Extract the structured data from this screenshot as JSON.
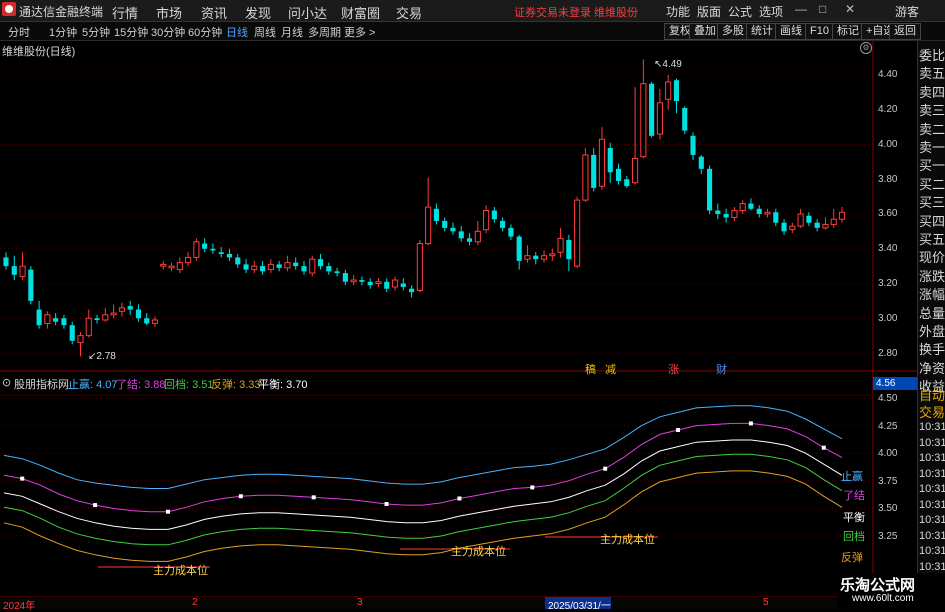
{
  "titlebar": {
    "app_name": "通达信金融终端",
    "menus": [
      "行情",
      "市场",
      "资讯",
      "发现",
      "问小达",
      "财富圈",
      "交易"
    ],
    "warning": "证券交易未登录 维维股份",
    "right": [
      "功能",
      "版面",
      "公式",
      "选项"
    ],
    "guest": "游客"
  },
  "toolbar": {
    "periods": [
      "分时",
      "1分钟",
      "5分钟",
      "15分钟",
      "30分钟",
      "60分钟",
      "日线",
      "周线",
      "月线",
      "多周期",
      "更多 >"
    ],
    "active_period": "日线",
    "buttons": [
      "复权",
      "叠加",
      "多股",
      "统计",
      "画线",
      "F10",
      "标记",
      "+自选",
      "返回"
    ]
  },
  "sidebar": {
    "items": [
      "委比",
      "卖五",
      "卖四",
      "卖三",
      "卖二",
      "卖一",
      "买一",
      "买二",
      "买三",
      "买四",
      "买五",
      "现价",
      "涨跌",
      "涨幅",
      "总量",
      "外盘",
      "换手",
      "净资",
      "收益"
    ],
    "bottom": [
      "自动",
      "交易",
      "10:31",
      "10:31",
      "10:31",
      "10:31",
      "10:31",
      "10:31",
      "10:31",
      "10:31",
      "10:31",
      "10:31",
      "10:32"
    ]
  },
  "main_chart": {
    "label": "维维股份(日线)",
    "price_ticks": [
      "4.40",
      "4.20",
      "4.00",
      "3.80",
      "3.60",
      "3.40",
      "3.20",
      "3.00",
      "2.80"
    ],
    "high_label": "4.49",
    "low_label": "2.78",
    "events": [
      {
        "text": "稿",
        "color": "#e8c200"
      },
      {
        "text": "减",
        "color": "#e8c200"
      },
      {
        "text": "涨",
        "color": "#ff4040"
      },
      {
        "text": "财",
        "color": "#4a8cff"
      }
    ]
  },
  "indicator": {
    "name": "股朋指标网",
    "legend": [
      {
        "label": "止赢:",
        "value": "4.07",
        "color": "#4ab3ff"
      },
      {
        "label": "了结:",
        "value": "3.88",
        "color": "#e040e0"
      },
      {
        "label": "回档:",
        "value": "3.51",
        "color": "#40d040"
      },
      {
        "label": "反弹:",
        "value": "3.33",
        "color": "#e0a020"
      },
      {
        "label": "平衡:",
        "value": "3.70",
        "color": "#ffffff"
      }
    ],
    "price_box": "4.56",
    "ticks": [
      "4.50",
      "4.25",
      "4.00",
      "3.75",
      "3.50",
      "3.25"
    ],
    "line_labels": [
      "止赢",
      "了结",
      "平衡",
      "回档",
      "反弹"
    ],
    "cost_label": "主力成本位"
  },
  "date_axis": [
    "2024年",
    "2",
    "3",
    "2025/03/31/一",
    "5"
  ],
  "watermark": {
    "title": "乐淘公式网",
    "url": "www.60lt.com"
  },
  "colors": {
    "up": "#ff3c3c",
    "down": "#00e0e0",
    "ma": "#ffffff"
  },
  "candles": [
    [
      3.35,
      3.3,
      3.38,
      3.28
    ],
    [
      3.3,
      3.25,
      3.36,
      3.22
    ],
    [
      3.24,
      3.3,
      3.38,
      3.22
    ],
    [
      3.28,
      3.1,
      3.3,
      3.08
    ],
    [
      3.05,
      2.96,
      3.1,
      2.94
    ],
    [
      2.97,
      3.02,
      3.04,
      2.94
    ],
    [
      3.0,
      2.98,
      3.03,
      2.96
    ],
    [
      3.0,
      2.96,
      3.02,
      2.94
    ],
    [
      2.96,
      2.87,
      2.98,
      2.85
    ],
    [
      2.86,
      2.9,
      2.92,
      2.78
    ],
    [
      2.9,
      3.0,
      3.05,
      2.89
    ],
    [
      3.0,
      2.99,
      3.02,
      2.97
    ],
    [
      2.99,
      3.02,
      3.06,
      2.98
    ],
    [
      3.02,
      3.03,
      3.08,
      3.0
    ],
    [
      3.04,
      3.06,
      3.09,
      3.01
    ],
    [
      3.07,
      3.05,
      3.1,
      3.02
    ],
    [
      3.05,
      3.0,
      3.08,
      2.98
    ],
    [
      3.0,
      2.97,
      3.03,
      2.96
    ],
    [
      2.97,
      2.99,
      3.01,
      2.95
    ],
    [
      3.3,
      3.31,
      3.33,
      3.28
    ],
    [
      3.29,
      3.3,
      3.32,
      3.27
    ],
    [
      3.28,
      3.32,
      3.35,
      3.26
    ],
    [
      3.32,
      3.35,
      3.38,
      3.3
    ],
    [
      3.35,
      3.44,
      3.46,
      3.33
    ],
    [
      3.43,
      3.4,
      3.46,
      3.38
    ],
    [
      3.4,
      3.39,
      3.43,
      3.37
    ],
    [
      3.38,
      3.37,
      3.41,
      3.35
    ],
    [
      3.37,
      3.35,
      3.4,
      3.33
    ],
    [
      3.35,
      3.31,
      3.37,
      3.29
    ],
    [
      3.31,
      3.28,
      3.34,
      3.26
    ],
    [
      3.28,
      3.3,
      3.33,
      3.26
    ],
    [
      3.3,
      3.27,
      3.33,
      3.25
    ],
    [
      3.28,
      3.31,
      3.34,
      3.26
    ],
    [
      3.31,
      3.29,
      3.33,
      3.27
    ],
    [
      3.29,
      3.32,
      3.36,
      3.27
    ],
    [
      3.32,
      3.3,
      3.35,
      3.28
    ],
    [
      3.3,
      3.27,
      3.33,
      3.25
    ],
    [
      3.26,
      3.34,
      3.36,
      3.24
    ],
    [
      3.34,
      3.3,
      3.37,
      3.28
    ],
    [
      3.3,
      3.27,
      3.32,
      3.25
    ],
    [
      3.27,
      3.26,
      3.29,
      3.24
    ],
    [
      3.26,
      3.21,
      3.28,
      3.19
    ],
    [
      3.21,
      3.22,
      3.25,
      3.19
    ],
    [
      3.22,
      3.21,
      3.24,
      3.19
    ],
    [
      3.21,
      3.19,
      3.23,
      3.17
    ],
    [
      3.2,
      3.21,
      3.23,
      3.18
    ],
    [
      3.21,
      3.17,
      3.23,
      3.15
    ],
    [
      3.18,
      3.22,
      3.24,
      3.16
    ],
    [
      3.2,
      3.18,
      3.23,
      3.16
    ],
    [
      3.17,
      3.15,
      3.19,
      3.12
    ],
    [
      3.16,
      3.43,
      3.45,
      3.15
    ],
    [
      3.43,
      3.64,
      3.81,
      3.42
    ],
    [
      3.63,
      3.56,
      3.66,
      3.54
    ],
    [
      3.56,
      3.52,
      3.58,
      3.5
    ],
    [
      3.52,
      3.5,
      3.55,
      3.48
    ],
    [
      3.5,
      3.46,
      3.53,
      3.44
    ],
    [
      3.46,
      3.44,
      3.49,
      3.42
    ],
    [
      3.44,
      3.5,
      3.56,
      3.42
    ],
    [
      3.51,
      3.62,
      3.65,
      3.49
    ],
    [
      3.62,
      3.57,
      3.64,
      3.55
    ],
    [
      3.56,
      3.52,
      3.58,
      3.5
    ],
    [
      3.52,
      3.47,
      3.54,
      3.45
    ],
    [
      3.47,
      3.33,
      3.48,
      3.28
    ],
    [
      3.34,
      3.36,
      3.42,
      3.32
    ],
    [
      3.36,
      3.34,
      3.38,
      3.31
    ],
    [
      3.34,
      3.36,
      3.39,
      3.32
    ],
    [
      3.36,
      3.37,
      3.4,
      3.33
    ],
    [
      3.38,
      3.46,
      3.52,
      3.35
    ],
    [
      3.45,
      3.34,
      3.48,
      3.27
    ],
    [
      3.3,
      3.68,
      3.7,
      3.29
    ],
    [
      3.68,
      3.94,
      3.98,
      3.67
    ],
    [
      3.94,
      3.75,
      3.98,
      3.73
    ],
    [
      3.76,
      4.03,
      4.1,
      3.74
    ],
    [
      3.98,
      3.84,
      4.01,
      3.78
    ],
    [
      3.86,
      3.79,
      3.89,
      3.77
    ],
    [
      3.8,
      3.76,
      3.82,
      3.75
    ],
    [
      3.78,
      3.92,
      4.33,
      3.77
    ],
    [
      3.93,
      4.35,
      4.49,
      3.92
    ],
    [
      4.35,
      4.05,
      4.36,
      4.04
    ],
    [
      4.06,
      4.24,
      4.32,
      4.03
    ],
    [
      4.26,
      4.36,
      4.4,
      4.2
    ],
    [
      4.37,
      4.25,
      4.38,
      4.18
    ],
    [
      4.21,
      4.08,
      4.22,
      4.06
    ],
    [
      4.05,
      3.94,
      4.07,
      3.91
    ],
    [
      3.93,
      3.86,
      3.94,
      3.83
    ],
    [
      3.86,
      3.62,
      3.88,
      3.6
    ],
    [
      3.62,
      3.6,
      3.66,
      3.57
    ],
    [
      3.6,
      3.58,
      3.63,
      3.55
    ],
    [
      3.58,
      3.62,
      3.64,
      3.56
    ],
    [
      3.62,
      3.66,
      3.68,
      3.6
    ],
    [
      3.66,
      3.63,
      3.69,
      3.62
    ],
    [
      3.63,
      3.6,
      3.65,
      3.58
    ],
    [
      3.6,
      3.61,
      3.63,
      3.58
    ],
    [
      3.61,
      3.55,
      3.63,
      3.53
    ],
    [
      3.55,
      3.5,
      3.57,
      3.48
    ],
    [
      3.51,
      3.53,
      3.55,
      3.49
    ],
    [
      3.53,
      3.6,
      3.63,
      3.52
    ],
    [
      3.59,
      3.55,
      3.61,
      3.53
    ],
    [
      3.55,
      3.52,
      3.57,
      3.5
    ],
    [
      3.52,
      3.54,
      3.58,
      3.51
    ],
    [
      3.54,
      3.57,
      3.63,
      3.52
    ],
    [
      3.57,
      3.61,
      3.64,
      3.55
    ]
  ],
  "bands": {
    "zhiying": [
      3.98,
      3.95,
      3.89,
      3.82,
      3.76,
      3.73,
      3.71,
      3.69,
      3.68,
      3.68,
      3.72,
      3.76,
      3.78,
      3.8,
      3.81,
      3.81,
      3.8,
      3.79,
      3.78,
      3.77,
      3.75,
      3.73,
      3.72,
      3.72,
      3.74,
      3.78,
      3.81,
      3.84,
      3.87,
      3.88,
      3.9,
      3.94,
      3.99,
      4.04,
      4.14,
      4.25,
      4.33,
      4.37,
      4.41,
      4.42,
      4.43,
      4.43,
      4.41,
      4.38,
      4.31,
      4.22,
      4.13
    ],
    "liaojie": [
      3.8,
      3.77,
      3.71,
      3.63,
      3.57,
      3.53,
      3.5,
      3.48,
      3.47,
      3.47,
      3.51,
      3.56,
      3.59,
      3.61,
      3.62,
      3.62,
      3.61,
      3.6,
      3.59,
      3.58,
      3.56,
      3.54,
      3.53,
      3.53,
      3.55,
      3.59,
      3.62,
      3.65,
      3.68,
      3.69,
      3.71,
      3.75,
      3.81,
      3.86,
      3.96,
      4.08,
      4.17,
      4.21,
      4.25,
      4.26,
      4.27,
      4.27,
      4.25,
      4.22,
      4.15,
      4.05,
      3.96
    ],
    "pingheng": [
      3.64,
      3.61,
      3.54,
      3.47,
      3.41,
      3.37,
      3.34,
      3.32,
      3.31,
      3.31,
      3.35,
      3.4,
      3.43,
      3.45,
      3.46,
      3.46,
      3.45,
      3.44,
      3.43,
      3.42,
      3.4,
      3.38,
      3.37,
      3.37,
      3.39,
      3.43,
      3.46,
      3.49,
      3.52,
      3.54,
      3.56,
      3.6,
      3.66,
      3.71,
      3.81,
      3.93,
      4.02,
      4.06,
      4.1,
      4.11,
      4.12,
      4.12,
      4.1,
      4.07,
      4.0,
      3.9,
      3.8
    ],
    "huidang": [
      3.51,
      3.48,
      3.41,
      3.33,
      3.27,
      3.23,
      3.2,
      3.18,
      3.17,
      3.17,
      3.21,
      3.26,
      3.29,
      3.31,
      3.32,
      3.32,
      3.31,
      3.3,
      3.29,
      3.28,
      3.26,
      3.24,
      3.23,
      3.23,
      3.25,
      3.29,
      3.32,
      3.35,
      3.38,
      3.4,
      3.42,
      3.46,
      3.52,
      3.57,
      3.68,
      3.8,
      3.89,
      3.93,
      3.97,
      3.98,
      3.99,
      3.99,
      3.97,
      3.94,
      3.87,
      3.76,
      3.66
    ],
    "fantan": [
      3.37,
      3.33,
      3.25,
      3.18,
      3.12,
      3.08,
      3.05,
      3.03,
      3.02,
      3.02,
      3.06,
      3.11,
      3.14,
      3.16,
      3.17,
      3.17,
      3.16,
      3.15,
      3.14,
      3.13,
      3.11,
      3.09,
      3.08,
      3.08,
      3.1,
      3.14,
      3.17,
      3.2,
      3.23,
      3.25,
      3.27,
      3.31,
      3.37,
      3.42,
      3.53,
      3.65,
      3.74,
      3.78,
      3.82,
      3.83,
      3.84,
      3.84,
      3.82,
      3.79,
      3.72,
      3.61,
      3.51
    ]
  }
}
